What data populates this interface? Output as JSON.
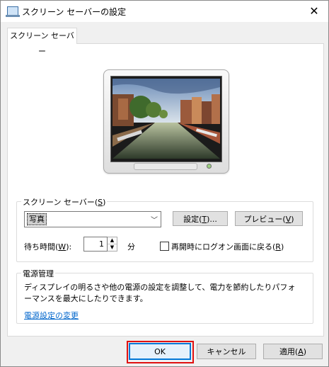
{
  "window": {
    "title": "スクリーン セーバーの設定",
    "close_glyph": "✕"
  },
  "tabs": [
    {
      "label": "スクリーン セーバー"
    }
  ],
  "screensaver": {
    "group_label_pre": "スクリーン セーバー(",
    "group_label_key": "S",
    "group_label_post": ")",
    "selected": "写真",
    "settings_pre": "設定(",
    "settings_key": "T",
    "settings_post": ")...",
    "preview_pre": "プレビュー(",
    "preview_key": "V",
    "preview_post": ")",
    "wait_pre": "待ち時間(",
    "wait_key": "W",
    "wait_post": "):",
    "wait_value": "1",
    "wait_unit": "分",
    "resume_pre": "再開時にログオン画面に戻る(",
    "resume_key": "R",
    "resume_post": ")",
    "resume_checked": false
  },
  "power": {
    "group_label": "電源管理",
    "description_line1": "ディスプレイの明るさや他の電源の設定を調整して、電力を節約したりパフォ",
    "description_line2": "ーマンスを最大にしたりできます。",
    "link": "電源設定の変更"
  },
  "buttons": {
    "ok": "OK",
    "cancel": "キャンセル",
    "apply_pre": "適用(",
    "apply_key": "A",
    "apply_post": ")"
  },
  "icons": [
    "app-icon",
    "close-icon",
    "dropdown-arrow-icon",
    "spin-up-icon",
    "spin-down-icon",
    "power-led-icon"
  ],
  "colors": {
    "link": "#0066cc",
    "focus": "#0078d7",
    "highlight": "#e01010"
  }
}
